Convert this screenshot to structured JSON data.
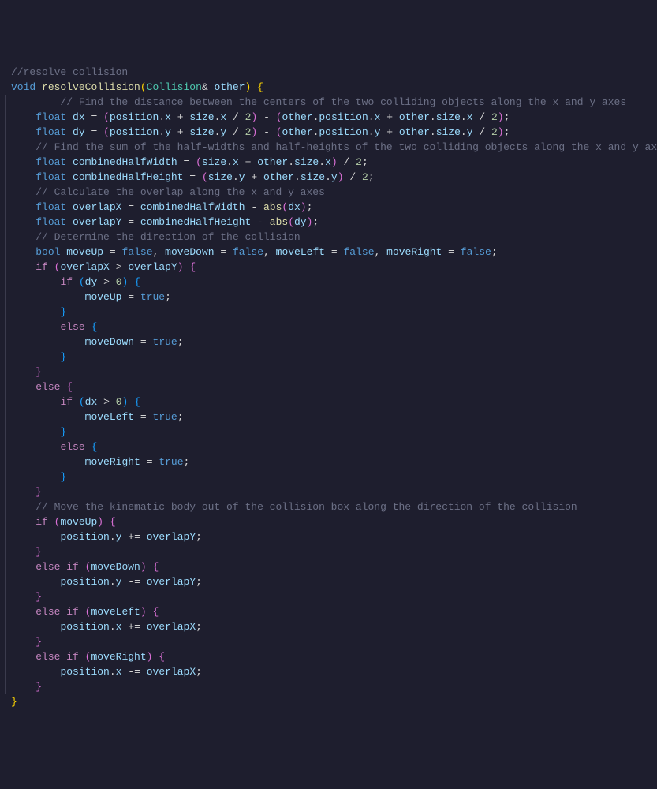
{
  "code": {
    "c1": "//resolve collision",
    "kw_void": "void",
    "fn_name": "resolveCollision",
    "cls_collision": "Collision",
    "param_other": "other",
    "c2": "// Find the distance between the centers of the two colliding objects along the x and y axes",
    "kw_float": "float",
    "v_dx": "dx",
    "v_dy": "dy",
    "v_position": "position",
    "v_size": "size",
    "v_other": "other",
    "p_x": "x",
    "p_y": "y",
    "n_2": "2",
    "n_0": "0",
    "c3": "// Find the sum of the half-widths and half-heights of the two colliding objects along the x and y axes",
    "v_chw": "combinedHalfWidth",
    "v_chh": "combinedHalfHeight",
    "c4": "// Calculate the overlap along the x and y axes",
    "v_ox": "overlapX",
    "v_oy": "overlapY",
    "fn_abs": "abs",
    "c5": "// Determine the direction of the collision",
    "kw_bool": "bool",
    "v_mu": "moveUp",
    "v_md": "moveDown",
    "v_ml": "moveLeft",
    "v_mr": "moveRight",
    "b_false": "false",
    "b_true": "true",
    "kw_if": "if",
    "kw_else": "else",
    "kw_elseif": "else if",
    "c6": "// Move the kinematic body out of the collision box along the direction of the collision"
  }
}
